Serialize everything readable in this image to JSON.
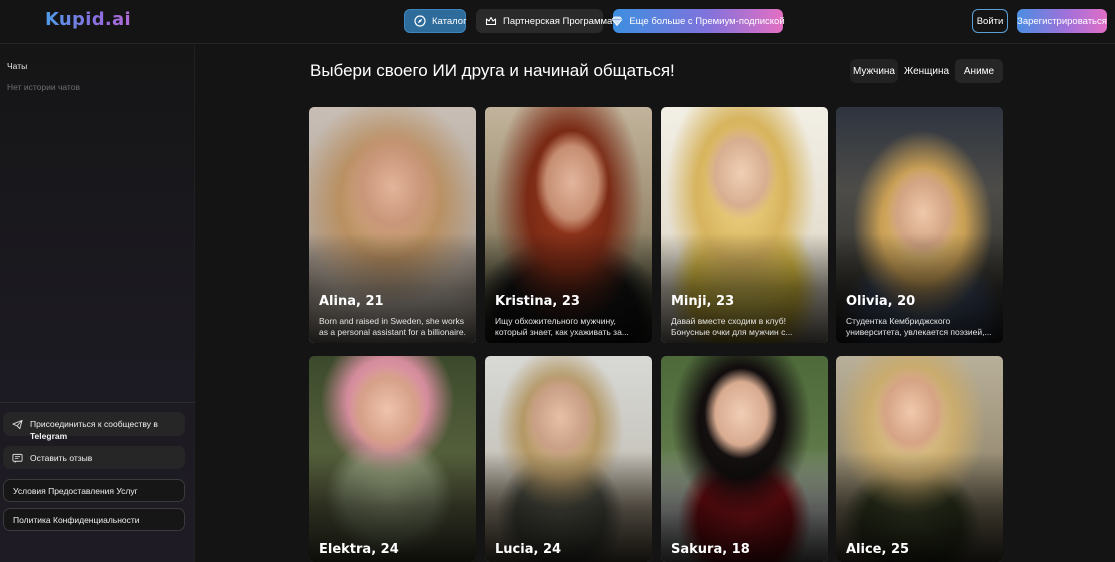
{
  "header": {
    "logo": "Kupid.ai",
    "catalog_label": "Каталог",
    "partner_label": "Партнерская Программа",
    "premium_label": "Еще больше с Премиум-подпиской",
    "login_label": "Войти",
    "register_label": "Зарегистрироваться"
  },
  "sidebar": {
    "chats_label": "Чаты",
    "empty_history": "Нет истории чатов",
    "telegram_label": "Присоединиться к сообществу в",
    "telegram_bold": "Telegram",
    "feedback_label": "Оставить отзыв",
    "terms_label": "Условия Предоставления Услуг",
    "privacy_label": "Политика Конфиденциальности"
  },
  "main": {
    "title": "Выбери своего ИИ друга и начинай общаться!",
    "filters": [
      "Мужчина",
      "Женщина",
      "Аниме"
    ],
    "cards": [
      {
        "name": "Alina, 21",
        "desc": "Born and raised in Sweden, she works as a personal assistant for a billionaire. Sh..."
      },
      {
        "name": "Kristina, 23",
        "desc": "Ищу обхожительного мужчину, который знает, как ухаживать за..."
      },
      {
        "name": "Minji, 23",
        "desc": "Давай вместе сходим в клуб! Бонусные очки для мужчин с..."
      },
      {
        "name": "Olivia, 20",
        "desc": "Студентка Кембриджского университета, увлекается поэзией,..."
      },
      {
        "name": "Elektra, 24",
        "desc": ""
      },
      {
        "name": "Lucia, 24",
        "desc": ""
      },
      {
        "name": "Sakura, 18",
        "desc": ""
      },
      {
        "name": "Alice, 25",
        "desc": ""
      }
    ]
  },
  "colors": {
    "background": "#141414",
    "accent_blue": "#2e6c9c",
    "gradient_start": "#3d8fe0",
    "gradient_end": "#e46fc3"
  },
  "icons": {
    "catalog": "compass-icon",
    "partner": "crown-icon",
    "premium": "diamond-icon",
    "telegram": "telegram-plane-icon",
    "feedback": "message-icon"
  }
}
